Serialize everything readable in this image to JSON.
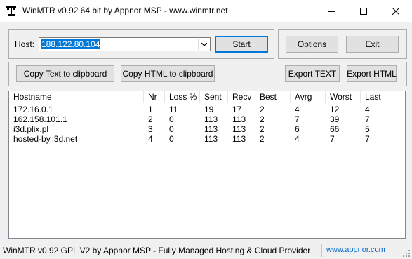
{
  "window": {
    "title": "WinMTR v0.92 64 bit by Appnor MSP - www.winmtr.net"
  },
  "host": {
    "label": "Host:",
    "value": "188.122.80.104"
  },
  "buttons": {
    "start": "Start",
    "options": "Options",
    "exit": "Exit",
    "copy_text": "Copy Text to clipboard",
    "copy_html": "Copy HTML to clipboard",
    "export_text": "Export TEXT",
    "export_html": "Export HTML"
  },
  "table": {
    "columns": [
      "Hostname",
      "Nr",
      "Loss %",
      "Sent",
      "Recv",
      "Best",
      "Avrg",
      "Worst",
      "Last"
    ],
    "rows": [
      [
        "172.16.0.1",
        "1",
        "11",
        "19",
        "17",
        "2",
        "4",
        "12",
        "4"
      ],
      [
        "162.158.101.1",
        "2",
        "0",
        "113",
        "113",
        "2",
        "7",
        "39",
        "7"
      ],
      [
        "i3d.plix.pl",
        "3",
        "0",
        "113",
        "113",
        "2",
        "6",
        "66",
        "5"
      ],
      [
        "hosted-by.i3d.net",
        "4",
        "0",
        "113",
        "113",
        "2",
        "4",
        "7",
        "7"
      ]
    ]
  },
  "status": {
    "text": "WinMTR v0.92 GPL V2 by Appnor MSP - Fully Managed Hosting & Cloud Provider",
    "link": "www.appnor.com"
  },
  "colors": {
    "selection": "#0078d7",
    "link": "#0066cc"
  }
}
